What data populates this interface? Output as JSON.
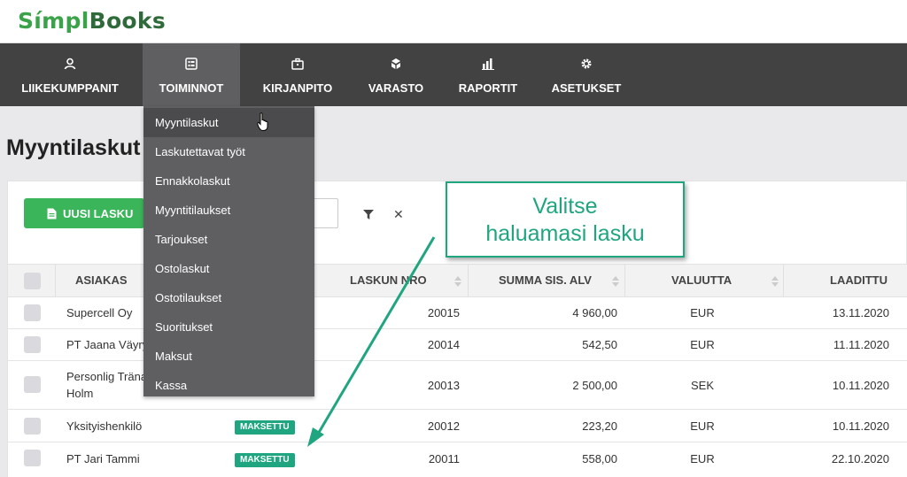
{
  "brand": {
    "logo_part1": "Símpl",
    "logo_part2": "Books"
  },
  "nav": {
    "items": [
      {
        "label": "LIIKEKUMPPANIT",
        "icon": "user-icon"
      },
      {
        "label": "TOIMINNOT",
        "icon": "list-icon",
        "active": true
      },
      {
        "label": "KIRJANPITO",
        "icon": "briefcase-icon"
      },
      {
        "label": "VARASTO",
        "icon": "boxes-icon"
      },
      {
        "label": "RAPORTIT",
        "icon": "bar-chart-icon"
      },
      {
        "label": "ASETUKSET",
        "icon": "gear-icon"
      }
    ]
  },
  "dropdown": {
    "items": [
      "Myyntilaskut",
      "Laskutettavat työt",
      "Ennakkolaskut",
      "Myyntitilaukset",
      "Tarjoukset",
      "Ostolaskut",
      "Ostotilaukset",
      "Suoritukset",
      "Maksut",
      "Kassa"
    ],
    "hovered_index": 0
  },
  "page": {
    "title": "Myyntilaskut"
  },
  "toolbar": {
    "new_invoice_label": "UUSI LASKU"
  },
  "table": {
    "columns": [
      "ASIAKAS",
      "LASKUN NRO",
      "SUMMA SIS. ALV",
      "VALUUTTA",
      "LAADITTU"
    ],
    "rows": [
      {
        "customer": "Supercell Oy",
        "status": "",
        "invoice_no": "20015",
        "amount": "4 960,00",
        "currency": "EUR",
        "created": "13.11.2020"
      },
      {
        "customer": "PT Jaana Väyry",
        "status": "",
        "invoice_no": "20014",
        "amount": "542,50",
        "currency": "EUR",
        "created": "11.11.2020"
      },
      {
        "customer": "Personlig Träna",
        "customer_line2": "Holm",
        "status": "",
        "invoice_no": "20013",
        "amount": "2 500,00",
        "currency": "SEK",
        "created": "10.11.2020"
      },
      {
        "customer": "Yksityishenkilö",
        "status": "MAKSETTU",
        "invoice_no": "20012",
        "amount": "223,20",
        "currency": "EUR",
        "created": "10.11.2020"
      },
      {
        "customer": "PT Jari Tammi",
        "status": "MAKSETTU",
        "invoice_no": "20011",
        "amount": "558,00",
        "currency": "EUR",
        "created": "22.10.2020"
      }
    ]
  },
  "callout": {
    "line1": "Valitse",
    "line2": "haluamasi lasku"
  },
  "colors": {
    "brand_green": "#3aa34a",
    "nav_bg": "#424242",
    "accent_teal": "#1fa580",
    "button_green": "#3ab55a"
  }
}
